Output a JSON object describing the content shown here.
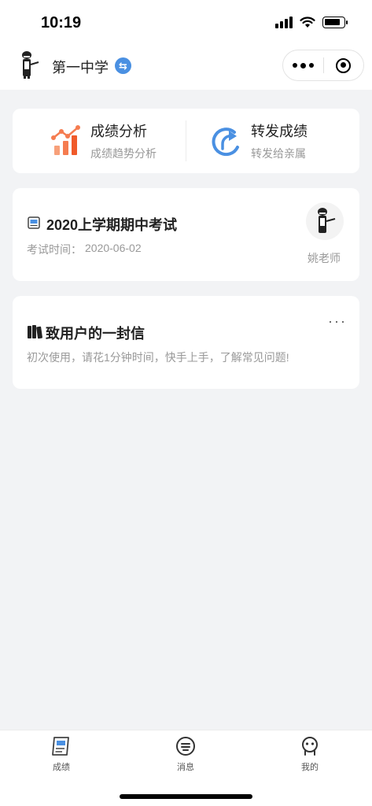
{
  "status": {
    "time": "10:19"
  },
  "nav": {
    "school_name": "第一中学"
  },
  "actions": [
    {
      "title": "成绩分析",
      "subtitle": "成绩趋势分析",
      "icon": "bar-chart-icon"
    },
    {
      "title": "转发成绩",
      "subtitle": "转发给亲属",
      "icon": "share-arrow-icon"
    }
  ],
  "exam": {
    "title": "2020上学期期中考试",
    "time_label": "考试时间：",
    "time_value": "2020-06-02",
    "teacher": "姚老师"
  },
  "letter": {
    "title": "致用户的一封信",
    "more": "···",
    "description": "初次使用，请花1分钟时间，快手上手，了解常见问题!"
  },
  "tabbar": [
    {
      "label": "成绩",
      "icon": "grades-icon"
    },
    {
      "label": "消息",
      "icon": "message-icon"
    },
    {
      "label": "我的",
      "icon": "profile-icon"
    }
  ],
  "colors": {
    "accent_blue": "#4a90e2",
    "chart_orange": "#f57c50",
    "background": "#f2f3f5"
  }
}
